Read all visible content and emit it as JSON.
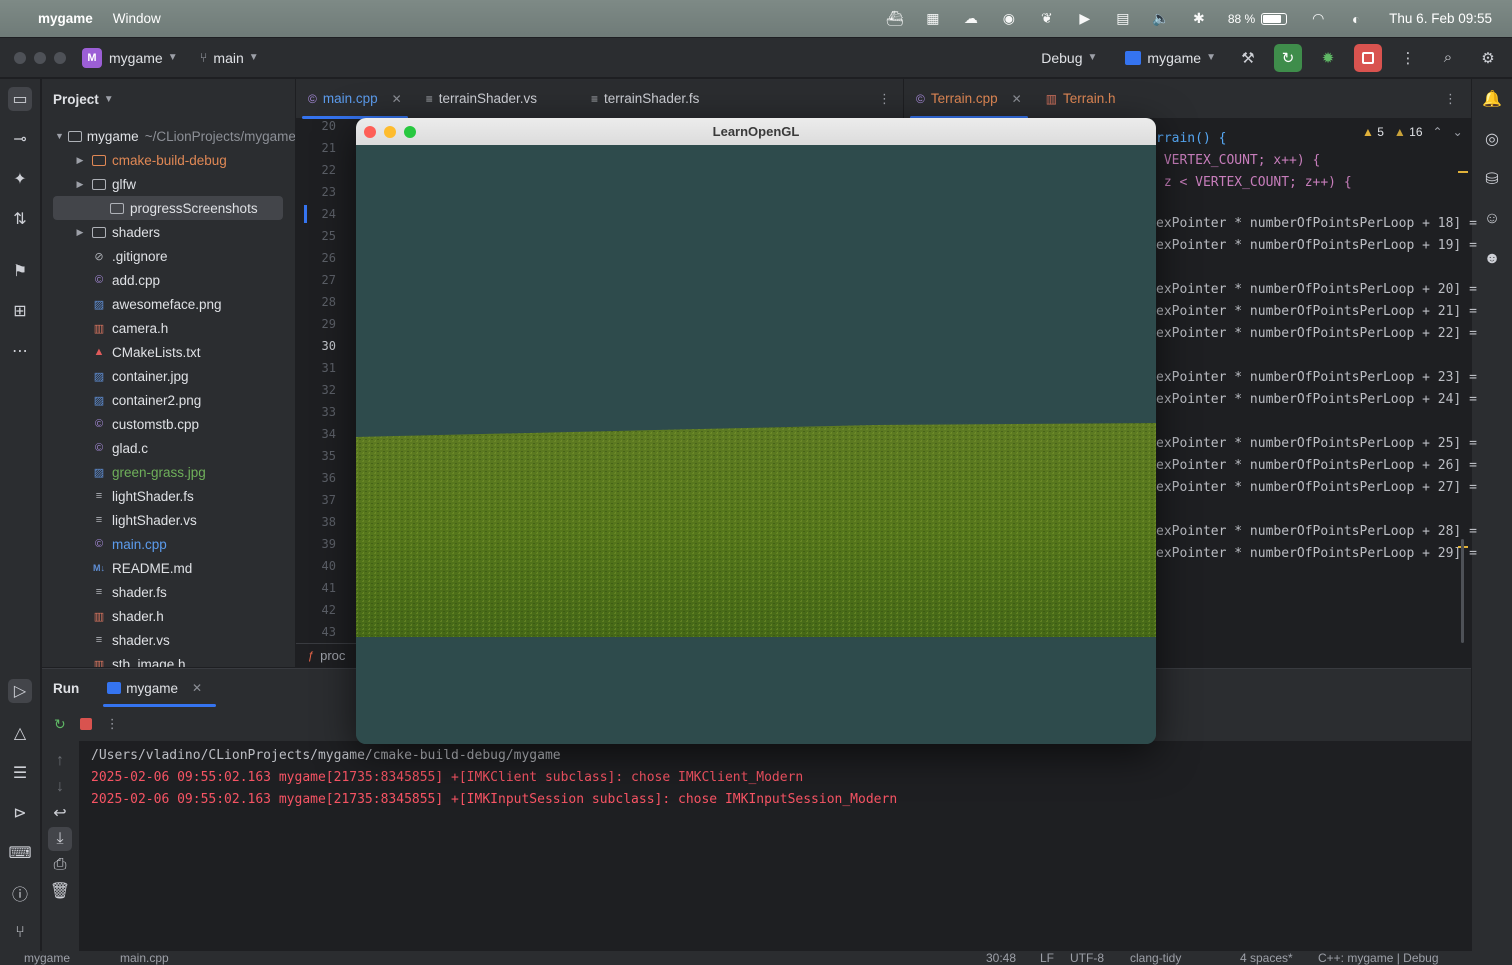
{
  "menubar": {
    "app_name": "mygame",
    "menu_window": "Window",
    "battery_pct": "88 %",
    "battery_level": 0.88,
    "clock": "Thu 6. Feb  09:55"
  },
  "titlebar": {
    "project_badge": "M",
    "project_name": "mygame",
    "branch": "main",
    "config": "Debug",
    "run_target": "mygame"
  },
  "project": {
    "title": "Project",
    "root_name": "mygame",
    "root_path": "~/CLionProjects/mygame",
    "items": [
      {
        "label": "cmake-build-debug",
        "kind": "folder-orange",
        "expandable": true
      },
      {
        "label": "glfw",
        "kind": "folder",
        "expandable": true
      },
      {
        "label": "progressScreenshots",
        "kind": "folder",
        "expandable": false,
        "selected": true
      },
      {
        "label": "shaders",
        "kind": "folder",
        "expandable": true
      },
      {
        "label": ".gitignore",
        "kind": "ignore"
      },
      {
        "label": "add.cpp",
        "kind": "cpp"
      },
      {
        "label": "awesomeface.png",
        "kind": "image"
      },
      {
        "label": "camera.h",
        "kind": "header"
      },
      {
        "label": "CMakeLists.txt",
        "kind": "cmake"
      },
      {
        "label": "container.jpg",
        "kind": "image"
      },
      {
        "label": "container2.png",
        "kind": "image"
      },
      {
        "label": "customstb.cpp",
        "kind": "cpp"
      },
      {
        "label": "glad.c",
        "kind": "c"
      },
      {
        "label": "green-grass.jpg",
        "kind": "image-green"
      },
      {
        "label": "lightShader.fs",
        "kind": "text"
      },
      {
        "label": "lightShader.vs",
        "kind": "text"
      },
      {
        "label": "main.cpp",
        "kind": "cpp-blue"
      },
      {
        "label": "README.md",
        "kind": "md"
      },
      {
        "label": "shader.fs",
        "kind": "text"
      },
      {
        "label": "shader.h",
        "kind": "header"
      },
      {
        "label": "shader.vs",
        "kind": "text"
      },
      {
        "label": "stb_image.h",
        "kind": "header"
      }
    ]
  },
  "editor": {
    "left_tabs": [
      {
        "label": "main.cpp",
        "active": true,
        "closable": true
      },
      {
        "label": "terrainShader.vs",
        "active": false
      },
      {
        "label": "terrainShader.fs",
        "active": false
      }
    ],
    "right_tabs": [
      {
        "label": "Terrain.cpp",
        "active": true,
        "closable": true
      },
      {
        "label": "Terrain.h",
        "active": false
      }
    ],
    "line_numbers": [
      "20",
      "21",
      "22",
      "23",
      "24",
      "25",
      "26",
      "27",
      "28",
      "29",
      "30",
      "31",
      "32",
      "33",
      "34",
      "35",
      "36",
      "37",
      "38",
      "39",
      "40",
      "41",
      "42",
      "43"
    ],
    "current_line": "30",
    "breadcrumb_fragment": "proc",
    "warnings_count": "5",
    "weak_warnings_count": "16",
    "code_lines": [
      {
        "text": "rrain() {"
      },
      {
        "text": " VERTEX_COUNT; x++) {"
      },
      {
        "text": " z < VERTEX_COUNT; z++) {"
      },
      {
        "text": ""
      },
      {
        "text": "exPointer * numberOfPointsPerLoop + 18] ="
      },
      {
        "text": "exPointer * numberOfPointsPerLoop + 19] ="
      },
      {
        "text": ""
      },
      {
        "text": "exPointer * numberOfPointsPerLoop + 20] ="
      },
      {
        "text": "exPointer * numberOfPointsPerLoop + 21] ="
      },
      {
        "text": "exPointer * numberOfPointsPerLoop + 22] ="
      },
      {
        "text": ""
      },
      {
        "text": "exPointer * numberOfPointsPerLoop + 23] ="
      },
      {
        "text": "exPointer * numberOfPointsPerLoop + 24] ="
      },
      {
        "text": ""
      },
      {
        "text": "exPointer * numberOfPointsPerLoop + 25] ="
      },
      {
        "text": "exPointer * numberOfPointsPerLoop + 26] ="
      },
      {
        "text": "exPointer * numberOfPointsPerLoop + 27] ="
      },
      {
        "text": ""
      },
      {
        "text": "exPointer * numberOfPointsPerLoop + 28] ="
      },
      {
        "text": "exPointer * numberOfPointsPerLoop + 29] ="
      }
    ]
  },
  "gl_window": {
    "title": "LearnOpenGL",
    "sky_color": "#2e4b4c",
    "grass_color": "#5a7a1c"
  },
  "run": {
    "tab_run": "Run",
    "tab_target": "mygame",
    "console": [
      {
        "text": "/Users/vladino/CLionProjects/mygame/cmake-build-debug/mygame",
        "color": "#bcbec4"
      },
      {
        "text": "2025-02-06 09:55:02.163 mygame[21735:8345855] +[IMKClient subclass]: chose IMKClient_Modern",
        "color": "#f75464"
      },
      {
        "text": "2025-02-06 09:55:02.163 mygame[21735:8345855] +[IMKInputSession subclass]: chose IMKInputSession_Modern",
        "color": "#f75464"
      }
    ]
  },
  "statusbar": {
    "crumb1": "mygame",
    "crumb2": "main.cpp",
    "position": "30:48",
    "line_sep": "LF",
    "encoding": "UTF-8",
    "lint": "clang-tidy",
    "indent": "4 spaces*",
    "lang": "C++: mygame | Debug"
  }
}
